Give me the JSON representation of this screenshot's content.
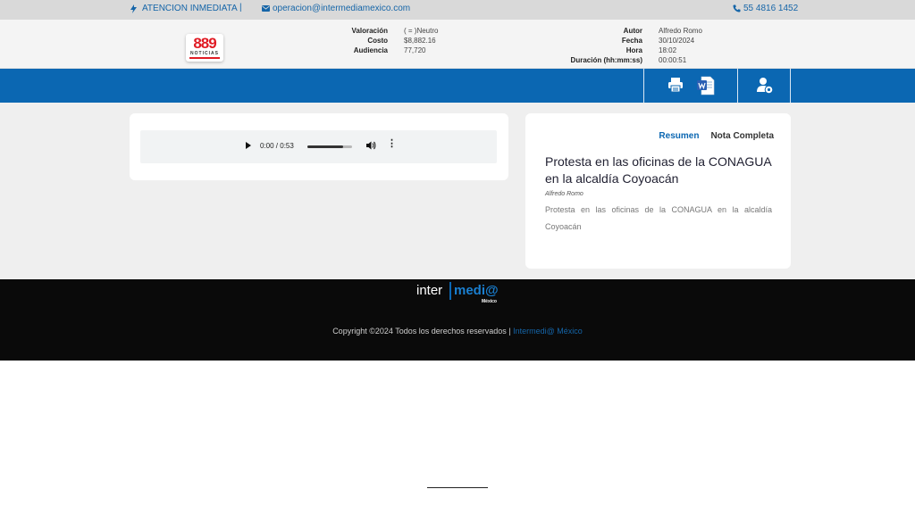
{
  "topbar": {
    "urgent_label": "ATENCION INMEDIATA",
    "separator": "|",
    "email": "operacion@intermediamexico.com",
    "phone": "55 4816 1452"
  },
  "logo": {
    "number": "889",
    "word": "NOTICIAS"
  },
  "meta": {
    "left": [
      {
        "key": "Valoración",
        "value": "( = )Neutro"
      },
      {
        "key": "Costo",
        "value": "$8,882.16"
      },
      {
        "key": "Audiencia",
        "value": "77,720"
      }
    ],
    "right": [
      {
        "key": "Autor",
        "value": "Alfredo Romo"
      },
      {
        "key": "Fecha",
        "value": "30/10/2024"
      },
      {
        "key": "Hora",
        "value": "18:02"
      },
      {
        "key": "Duración (hh:mm:ss)",
        "value": "00:00:51"
      }
    ]
  },
  "toolbar": {
    "icons": [
      "print-icon",
      "word-document-icon",
      "user-settings-icon"
    ]
  },
  "player": {
    "time": "0:00 / 0:53",
    "progress": 0.0,
    "volume": 0.8
  },
  "article": {
    "tabs": [
      "Resumen",
      "Nota Completa"
    ],
    "title": "Protesta en las oficinas de la CONAGUA en la alcaldía Coyoacán",
    "author": "Alfredo Romo",
    "summary": "Protesta en las oficinas de la CONAGUA en la alcaldía Coyoacán"
  },
  "footer": {
    "logo_inter": "inter",
    "logo_medi": "medi@",
    "logo_mexico": "México",
    "copyright": "Copyright ©2024 Todos los derechos reservados |",
    "brand_link": "Intermedi@ México"
  },
  "colors": {
    "accent": "#0b67b2",
    "topbar_bg": "#d9d9d9",
    "footer_bg": "#0a0a0a",
    "logo_red": "#e01b24"
  }
}
